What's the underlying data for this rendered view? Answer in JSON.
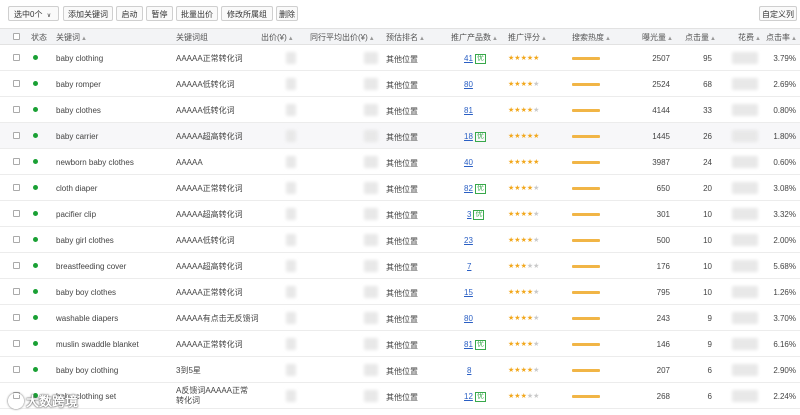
{
  "toolbar": {
    "select": "选中0个",
    "buttons": [
      "添加关键词",
      "启动",
      "暂停",
      "批量出价",
      "修改所属组",
      "删除"
    ],
    "custom_columns": "自定义列"
  },
  "headers": {
    "status": "状态",
    "keyword": "关键词",
    "group": "关键词组",
    "bid": "出价(¥)",
    "peer_avg": "同行平均出价(¥)",
    "rank": "预估排名",
    "products": "推广产品数",
    "rating": "推广评分",
    "heat": "搜索热度",
    "impressions": "曝光量",
    "clicks": "点击量",
    "cost": "花费",
    "ctr": "点击率"
  },
  "rows": [
    {
      "keyword": "baby clothing",
      "group": "AAAAA正常转化词",
      "rank": "其他位置",
      "products": "41",
      "optimize": true,
      "stars": 5,
      "impressions": "2507",
      "clicks": "95",
      "ctr": "3.79%"
    },
    {
      "keyword": "baby romper",
      "group": "AAAAA低转化词",
      "rank": "其他位置",
      "products": "80",
      "optimize": false,
      "stars": 4,
      "impressions": "2524",
      "clicks": "68",
      "ctr": "2.69%"
    },
    {
      "keyword": "baby clothes",
      "group": "AAAAA低转化词",
      "rank": "其他位置",
      "products": "81",
      "optimize": false,
      "stars": 4,
      "impressions": "4144",
      "clicks": "33",
      "ctr": "0.80%"
    },
    {
      "keyword": "baby carrier",
      "group": "AAAAA超高转化词",
      "rank": "其他位置",
      "products": "18",
      "optimize": true,
      "stars": 5,
      "impressions": "1445",
      "clicks": "26",
      "ctr": "1.80%"
    },
    {
      "keyword": "newborn baby clothes",
      "group": "AAAAA",
      "rank": "其他位置",
      "products": "40",
      "optimize": false,
      "stars": 5,
      "impressions": "3987",
      "clicks": "24",
      "ctr": "0.60%"
    },
    {
      "keyword": "cloth diaper",
      "group": "AAAAA正常转化词",
      "rank": "其他位置",
      "products": "82",
      "optimize": true,
      "stars": 4,
      "impressions": "650",
      "clicks": "20",
      "ctr": "3.08%"
    },
    {
      "keyword": "pacifier clip",
      "group": "AAAAA超高转化词",
      "rank": "其他位置",
      "products": "3",
      "optimize": true,
      "stars": 4,
      "impressions": "301",
      "clicks": "10",
      "ctr": "3.32%"
    },
    {
      "keyword": "baby girl clothes",
      "group": "AAAAA低转化词",
      "rank": "其他位置",
      "products": "23",
      "optimize": false,
      "stars": 4,
      "impressions": "500",
      "clicks": "10",
      "ctr": "2.00%"
    },
    {
      "keyword": "breastfeeding cover",
      "group": "AAAAA超高转化词",
      "rank": "其他位置",
      "products": "7",
      "optimize": false,
      "stars": 3,
      "impressions": "176",
      "clicks": "10",
      "ctr": "5.68%"
    },
    {
      "keyword": "baby boy clothes",
      "group": "AAAAA正常转化词",
      "rank": "其他位置",
      "products": "15",
      "optimize": false,
      "stars": 4,
      "impressions": "795",
      "clicks": "10",
      "ctr": "1.26%"
    },
    {
      "keyword": "washable diapers",
      "group": "AAAAA有点击无反馈词",
      "rank": "其他位置",
      "products": "80",
      "optimize": false,
      "stars": 4,
      "impressions": "243",
      "clicks": "9",
      "ctr": "3.70%"
    },
    {
      "keyword": "muslin swaddle blanket",
      "group": "AAAAA正常转化词",
      "rank": "其他位置",
      "products": "81",
      "optimize": true,
      "stars": 4,
      "impressions": "146",
      "clicks": "9",
      "ctr": "6.16%"
    },
    {
      "keyword": "baby boy clothing",
      "group": "3到5星",
      "rank": "其他位置",
      "products": "8",
      "optimize": false,
      "stars": 4,
      "impressions": "207",
      "clicks": "6",
      "ctr": "2.90%"
    },
    {
      "keyword": "baby clothing set",
      "group": "A反馈词AAAAA正常转化词",
      "rank": "其他位置",
      "products": "12",
      "optimize": true,
      "stars": 3,
      "impressions": "268",
      "clicks": "6",
      "ctr": "2.24%"
    }
  ],
  "optimize_label": "优",
  "watermark": "大数跨境",
  "colors": {
    "status_green": "#1aa034",
    "star": "#f2a81e",
    "heat": "#f1b546",
    "link": "#2a5fc4"
  }
}
